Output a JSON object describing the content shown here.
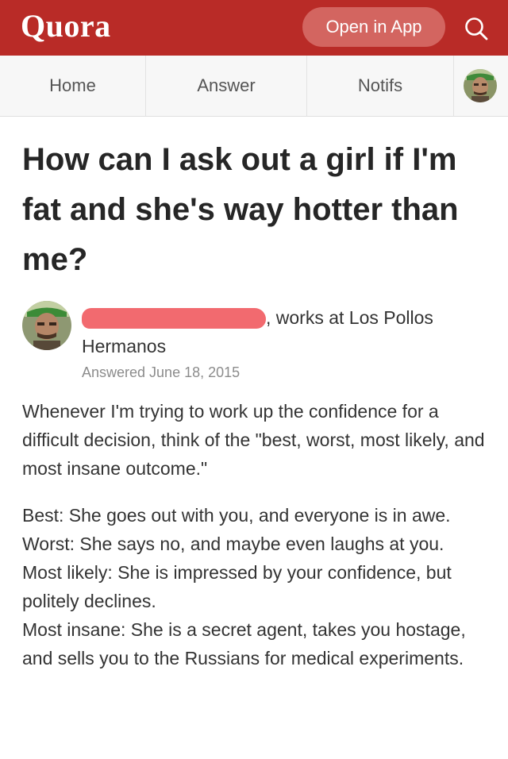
{
  "header": {
    "logo": "Quora",
    "open_in_app": "Open in App",
    "search_icon": "search-icon",
    "brand_color": "#b92b27"
  },
  "nav": {
    "tabs": [
      "Home",
      "Answer",
      "Notifs"
    ],
    "avatar_icon": "profile-avatar"
  },
  "question": {
    "title": "How can I ask out a girl if I'm fat and she's way hotter than me?"
  },
  "author": {
    "credential": ", works at Los Pollos Hermanos",
    "answered": "Answered June 18, 2015",
    "redaction_color": "#f26a6f"
  },
  "answer": {
    "intro": "Whenever I'm trying to work up the confidence for a difficult decision,   think of the \"best, worst, most likely, and most insane outcome.\"",
    "lines": [
      "Best: She goes out with you, and everyone is in awe.",
      "Worst: She says no, and maybe even laughs at you.",
      "Most likely: She is impressed by your confidence, but politely declines.",
      "Most insane: She is a secret agent, takes you hostage, and sells you to the Russians for medical experiments."
    ]
  }
}
